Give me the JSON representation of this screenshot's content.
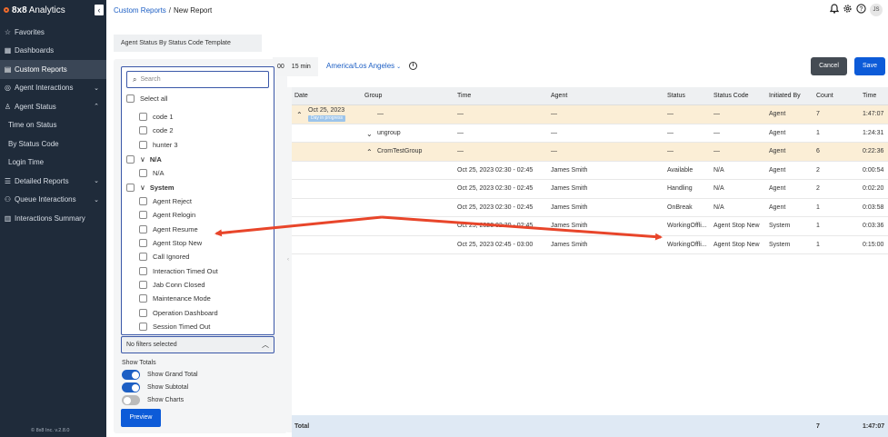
{
  "app": {
    "brand_bold": "8x8",
    "brand_rest": "Analytics",
    "version": "© 8x8 Inc. v.2.8.0",
    "user_initials": "JS"
  },
  "sidebar": {
    "items": [
      {
        "label": "Favorites",
        "icon": "star-icon"
      },
      {
        "label": "Dashboards",
        "icon": "dashboard-icon"
      },
      {
        "label": "Custom Reports",
        "icon": "report-icon",
        "active": true
      },
      {
        "label": "Agent Interactions",
        "icon": "headset-icon",
        "expandable": true
      },
      {
        "label": "Agent Status",
        "icon": "person-icon",
        "expandable": true,
        "expanded": true
      },
      {
        "label": "Time on Status",
        "sub": true
      },
      {
        "label": "By Status Code",
        "sub": true
      },
      {
        "label": "Login Time",
        "sub": true
      },
      {
        "label": "Detailed Reports",
        "icon": "list-icon",
        "expandable": true
      },
      {
        "label": "Queue Interactions",
        "icon": "people-icon",
        "expandable": true
      },
      {
        "label": "Interactions Summary",
        "icon": "table-icon"
      }
    ]
  },
  "breadcrumb": {
    "link": "Custom Reports",
    "sep": "/",
    "current": "New Report"
  },
  "template_tab": "Agent Status By Status Code Template",
  "controls": {
    "interval_prefix": "00",
    "interval": "15 min",
    "timezone": "America/Los Angeles",
    "cancel": "Cancel",
    "save": "Save"
  },
  "filter_dropdown": {
    "search_placeholder": "Search",
    "select_all": "Select all",
    "options": [
      {
        "label": "code 1",
        "level": 1
      },
      {
        "label": "code 2",
        "level": 1
      },
      {
        "label": "hunter 3",
        "level": 1
      },
      {
        "label": "N/A",
        "level": 0,
        "group": true
      },
      {
        "label": "N/A",
        "level": 1
      },
      {
        "label": "System",
        "level": 0,
        "group": true
      },
      {
        "label": "Agent Reject",
        "level": 1
      },
      {
        "label": "Agent Relogin",
        "level": 1
      },
      {
        "label": "Agent Resume",
        "level": 1
      },
      {
        "label": "Agent Stop New",
        "level": 1
      },
      {
        "label": "Call Ignored",
        "level": 1
      },
      {
        "label": "Interaction Timed Out",
        "level": 1
      },
      {
        "label": "Jab Conn Closed",
        "level": 1
      },
      {
        "label": "Maintenance Mode",
        "level": 1
      },
      {
        "label": "Operation Dashboard",
        "level": 1
      },
      {
        "label": "Session Timed Out",
        "level": 1
      }
    ],
    "selected_text": "No filters selected"
  },
  "totals": {
    "label": "Show Totals",
    "toggles": [
      {
        "label": "Show Grand Total",
        "on": true
      },
      {
        "label": "Show Subtotal",
        "on": true
      },
      {
        "label": "Show Charts",
        "on": false
      }
    ],
    "preview": "Preview"
  },
  "table": {
    "columns": [
      "Date",
      "Group",
      "Time",
      "Agent",
      "Status",
      "Status Code",
      "Initiated By",
      "Count",
      "Time"
    ],
    "rows": [
      {
        "date": "Oct 25, 2023",
        "badge": "Day in progress",
        "group": "—",
        "time": "—",
        "agent": "—",
        "status": "—",
        "code": "—",
        "initiated": "Agent",
        "count": "7",
        "dur": "1:47:07",
        "hl": true,
        "caret": "^"
      },
      {
        "date": "",
        "group": "ungroup",
        "time": "—",
        "agent": "—",
        "status": "—",
        "code": "—",
        "initiated": "Agent",
        "count": "1",
        "dur": "1:24:31",
        "caret": "v"
      },
      {
        "date": "",
        "group": "CromTestGroup",
        "time": "—",
        "agent": "—",
        "status": "—",
        "code": "—",
        "initiated": "Agent",
        "count": "6",
        "dur": "0:22:36",
        "hl": true,
        "caret": "^"
      },
      {
        "date": "",
        "group": "",
        "time": "Oct 25, 2023 02:30 - 02:45",
        "agent": "James Smith",
        "status": "Available",
        "code": "N/A",
        "initiated": "Agent",
        "count": "2",
        "dur": "0:00:54"
      },
      {
        "date": "",
        "group": "",
        "time": "Oct 25, 2023 02:30 - 02:45",
        "agent": "James Smith",
        "status": "Handling",
        "code": "N/A",
        "initiated": "Agent",
        "count": "2",
        "dur": "0:02:20"
      },
      {
        "date": "",
        "group": "",
        "time": "Oct 25, 2023 02:30 - 02:45",
        "agent": "James Smith",
        "status": "OnBreak",
        "code": "N/A",
        "initiated": "Agent",
        "count": "1",
        "dur": "0:03:58"
      },
      {
        "date": "",
        "group": "",
        "time": "Oct 25, 2023 02:30 - 02:45",
        "agent": "James Smith",
        "status": "WorkingOffli...",
        "code": "Agent Stop New",
        "initiated": "System",
        "count": "1",
        "dur": "0:03:36"
      },
      {
        "date": "",
        "group": "",
        "time": "Oct 25, 2023 02:45 - 03:00",
        "agent": "James Smith",
        "status": "WorkingOffli...",
        "code": "Agent Stop New",
        "initiated": "System",
        "count": "1",
        "dur": "0:15:00"
      }
    ],
    "total": {
      "label": "Total",
      "count": "7",
      "dur": "1:47:07"
    }
  },
  "annotation": {
    "arrow_color": "#e8452a"
  }
}
